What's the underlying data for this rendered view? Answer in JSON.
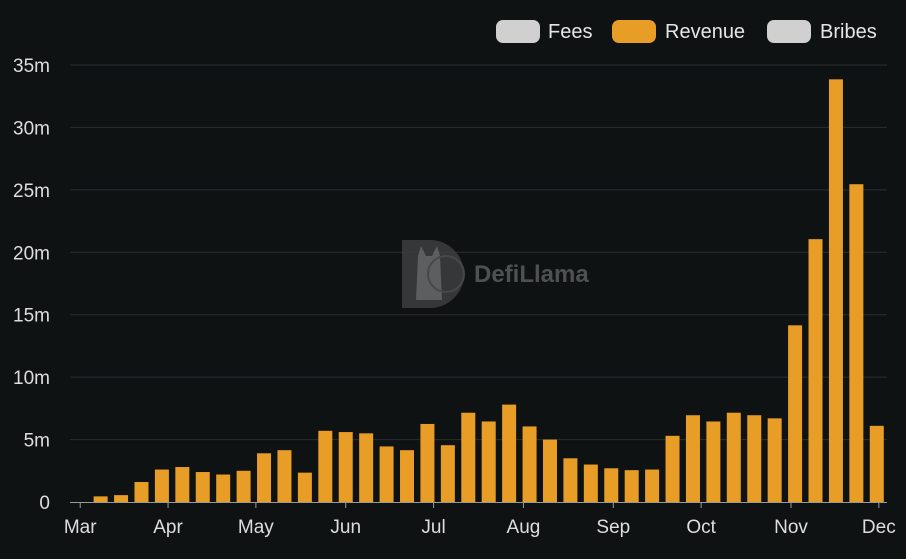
{
  "chart_data": {
    "type": "bar",
    "legend": [
      {
        "name": "Fees",
        "color": "#d0d0d0",
        "active": false
      },
      {
        "name": "Revenue",
        "color": "#e89d27",
        "active": true
      },
      {
        "name": "Bribes",
        "color": "#d0d0d0",
        "active": false
      }
    ],
    "legend_position": "top-right",
    "y_ticks": [
      {
        "value": 0,
        "label": "0"
      },
      {
        "value": 5000000,
        "label": "5m"
      },
      {
        "value": 10000000,
        "label": "10m"
      },
      {
        "value": 15000000,
        "label": "15m"
      },
      {
        "value": 20000000,
        "label": "20m"
      },
      {
        "value": 25000000,
        "label": "25m"
      },
      {
        "value": 30000000,
        "label": "30m"
      },
      {
        "value": 35000000,
        "label": "35m"
      }
    ],
    "x_ticks": [
      {
        "label": "Mar",
        "week": 0
      },
      {
        "label": "Apr",
        "week": 4.3
      },
      {
        "label": "May",
        "week": 8.6
      },
      {
        "label": "Jun",
        "week": 13
      },
      {
        "label": "Jul",
        "week": 17.3
      },
      {
        "label": "Aug",
        "week": 21.7
      },
      {
        "label": "Sep",
        "week": 26.1
      },
      {
        "label": "Oct",
        "week": 30.4
      },
      {
        "label": "Nov",
        "week": 34.8
      },
      {
        "label": "Dec",
        "week": 39.1
      }
    ],
    "ylim": [
      0,
      37000000
    ],
    "grid": true,
    "series": [
      {
        "name": "Revenue",
        "color": "#e89d27",
        "values": [
          0,
          450000,
          550000,
          1600000,
          2600000,
          2800000,
          2400000,
          2200000,
          2500000,
          3900000,
          4150000,
          2350000,
          5700000,
          5600000,
          5500000,
          4450000,
          4150000,
          6250000,
          4550000,
          7150000,
          6450000,
          7800000,
          6050000,
          5000000,
          3500000,
          3000000,
          2700000,
          2550000,
          2600000,
          5300000,
          6950000,
          6450000,
          7150000,
          6950000,
          6700000,
          14150000,
          21050000,
          33850000,
          25450000,
          6100000
        ]
      }
    ]
  },
  "watermark": {
    "text": "DefiLlama"
  }
}
